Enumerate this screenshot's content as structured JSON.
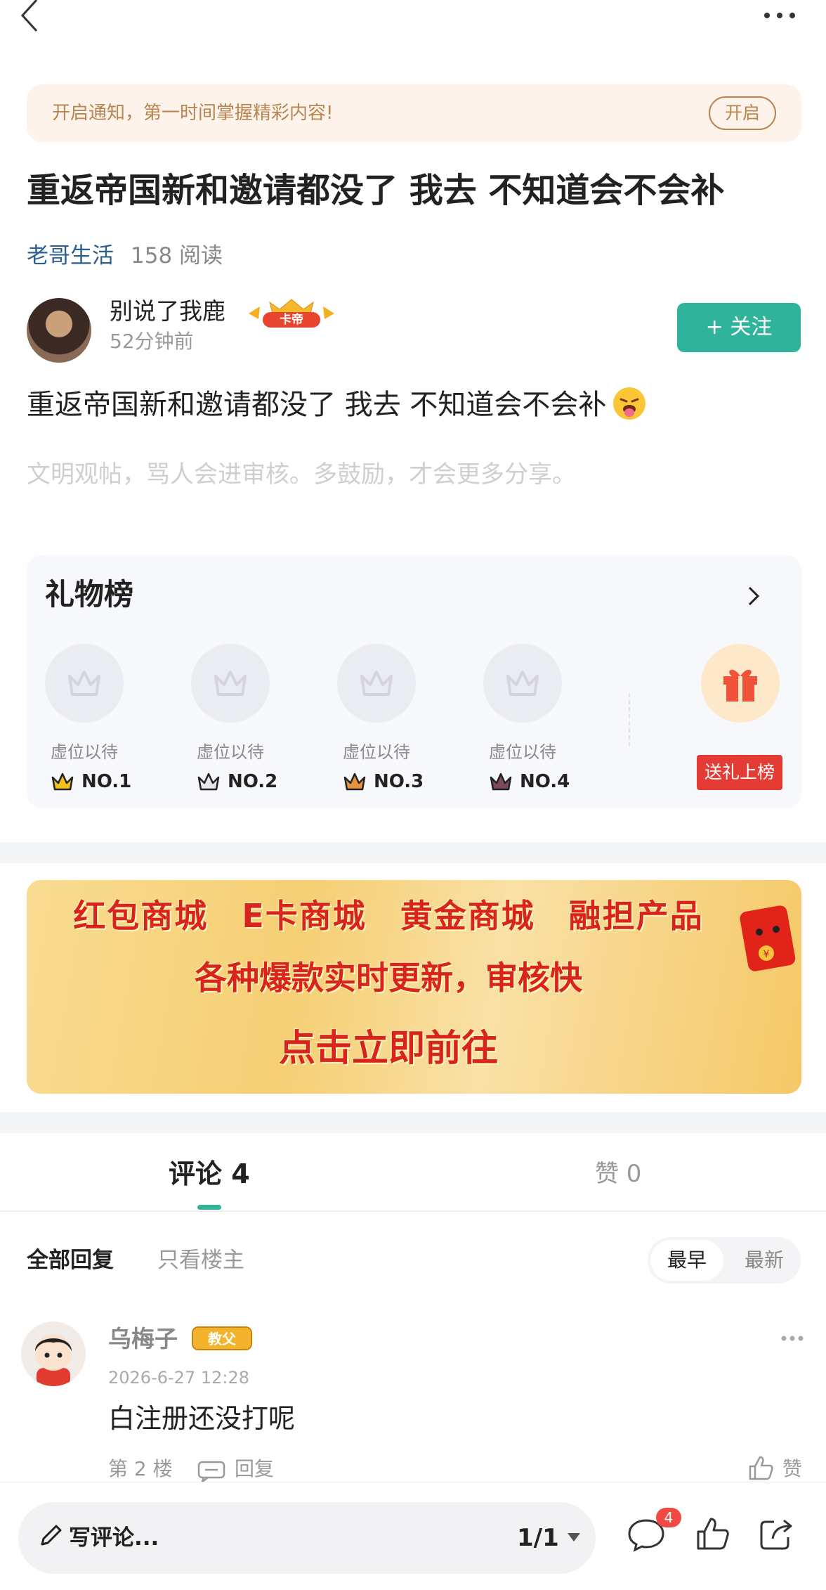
{
  "notification": {
    "text": "开启通知，第一时间掌握精彩内容!",
    "button": "开启"
  },
  "post": {
    "title": "重返帝国新和邀请都没了 我去 不知道会不会补",
    "forum": "老哥生活",
    "reads": "158 阅读",
    "author": {
      "name": "别说了我鹿",
      "time": "52分钟前",
      "badge": "卡帝"
    },
    "follow_label": "关注",
    "body": "重返帝国新和邀请都没了 我去 不知道会不会补",
    "civil_hint": "文明观帖，骂人会进审核。多鼓励，才会更多分享。"
  },
  "gift_board": {
    "title": "礼物榜",
    "slots": [
      {
        "placeholder": "虚位以待",
        "rank": "NO.1"
      },
      {
        "placeholder": "虚位以待",
        "rank": "NO.2"
      },
      {
        "placeholder": "虚位以待",
        "rank": "NO.3"
      },
      {
        "placeholder": "虚位以待",
        "rank": "NO.4"
      }
    ],
    "send_label": "送礼上榜"
  },
  "ad": {
    "line1": "红包商城 E卡商城 黄金商城 融担产品",
    "line2": "各种爆款实时更新，审核快",
    "line3": "点击立即前往"
  },
  "tabs": {
    "comments": "评论 4",
    "likes": "赞 0"
  },
  "filters": {
    "all": "全部回复",
    "op_only": "只看楼主",
    "sort_early": "最早",
    "sort_new": "最新"
  },
  "comment": {
    "name": "乌梅子",
    "badge": "教父",
    "time": "2026-6-27 12:28",
    "text": "白注册还没打呢",
    "floor": "第 2 楼",
    "reply": "回复",
    "like": "赞"
  },
  "bottom_bar": {
    "write": "写评论...",
    "page": "1/1",
    "comment_count": "4"
  },
  "colors": {
    "accent": "#2fb39b",
    "danger": "#e53b35",
    "notify_bg": "#fdf3ea",
    "notify_text": "#b8844f"
  }
}
